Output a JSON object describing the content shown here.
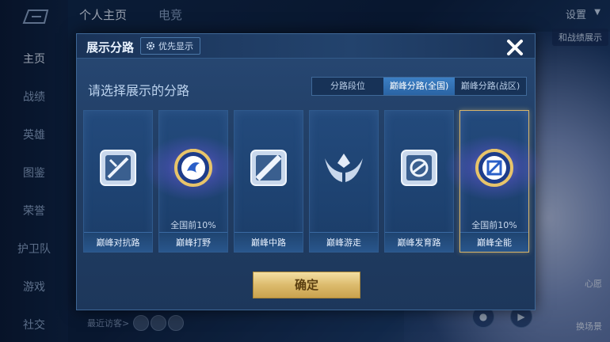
{
  "background": {
    "top_tabs": [
      "个人主页",
      "电竞"
    ],
    "active_tab": "个人主页",
    "settings_label": "设置",
    "show_tag": "和战绩展示",
    "nav": [
      "主页",
      "战绩",
      "英雄",
      "图鉴",
      "荣誉",
      "护卫队",
      "游戏",
      "社交"
    ],
    "visitors_label": "最近访客>",
    "side_labels": [
      "心愿",
      "换场景"
    ]
  },
  "modal": {
    "title": "展示分路",
    "priority_label": "优先显示",
    "subtitle": "请选择展示的分路",
    "segments": [
      "分路段位",
      "巅峰分路(全国)",
      "巅峰分路(战区)"
    ],
    "active_segment": 1,
    "cards": [
      {
        "label": "巅峰对抗路",
        "rank": "",
        "icon": "clash-lane-icon",
        "selected": false
      },
      {
        "label": "巅峰打野",
        "rank": "全国前10%",
        "icon": "jungle-medal-icon",
        "selected": false
      },
      {
        "label": "巅峰中路",
        "rank": "",
        "icon": "mid-lane-icon",
        "selected": false
      },
      {
        "label": "巅峰游走",
        "rank": "",
        "icon": "roam-icon",
        "selected": false
      },
      {
        "label": "巅峰发育路",
        "rank": "",
        "icon": "farm-lane-icon",
        "selected": false
      },
      {
        "label": "巅峰全能",
        "rank": "全国前10%",
        "icon": "all-round-medal-icon",
        "selected": true
      }
    ],
    "confirm_label": "确定"
  },
  "colors": {
    "accent_gold": "#dcbb6d",
    "segment_active": "#2a64a4",
    "selected_border": "#d8b56a"
  }
}
